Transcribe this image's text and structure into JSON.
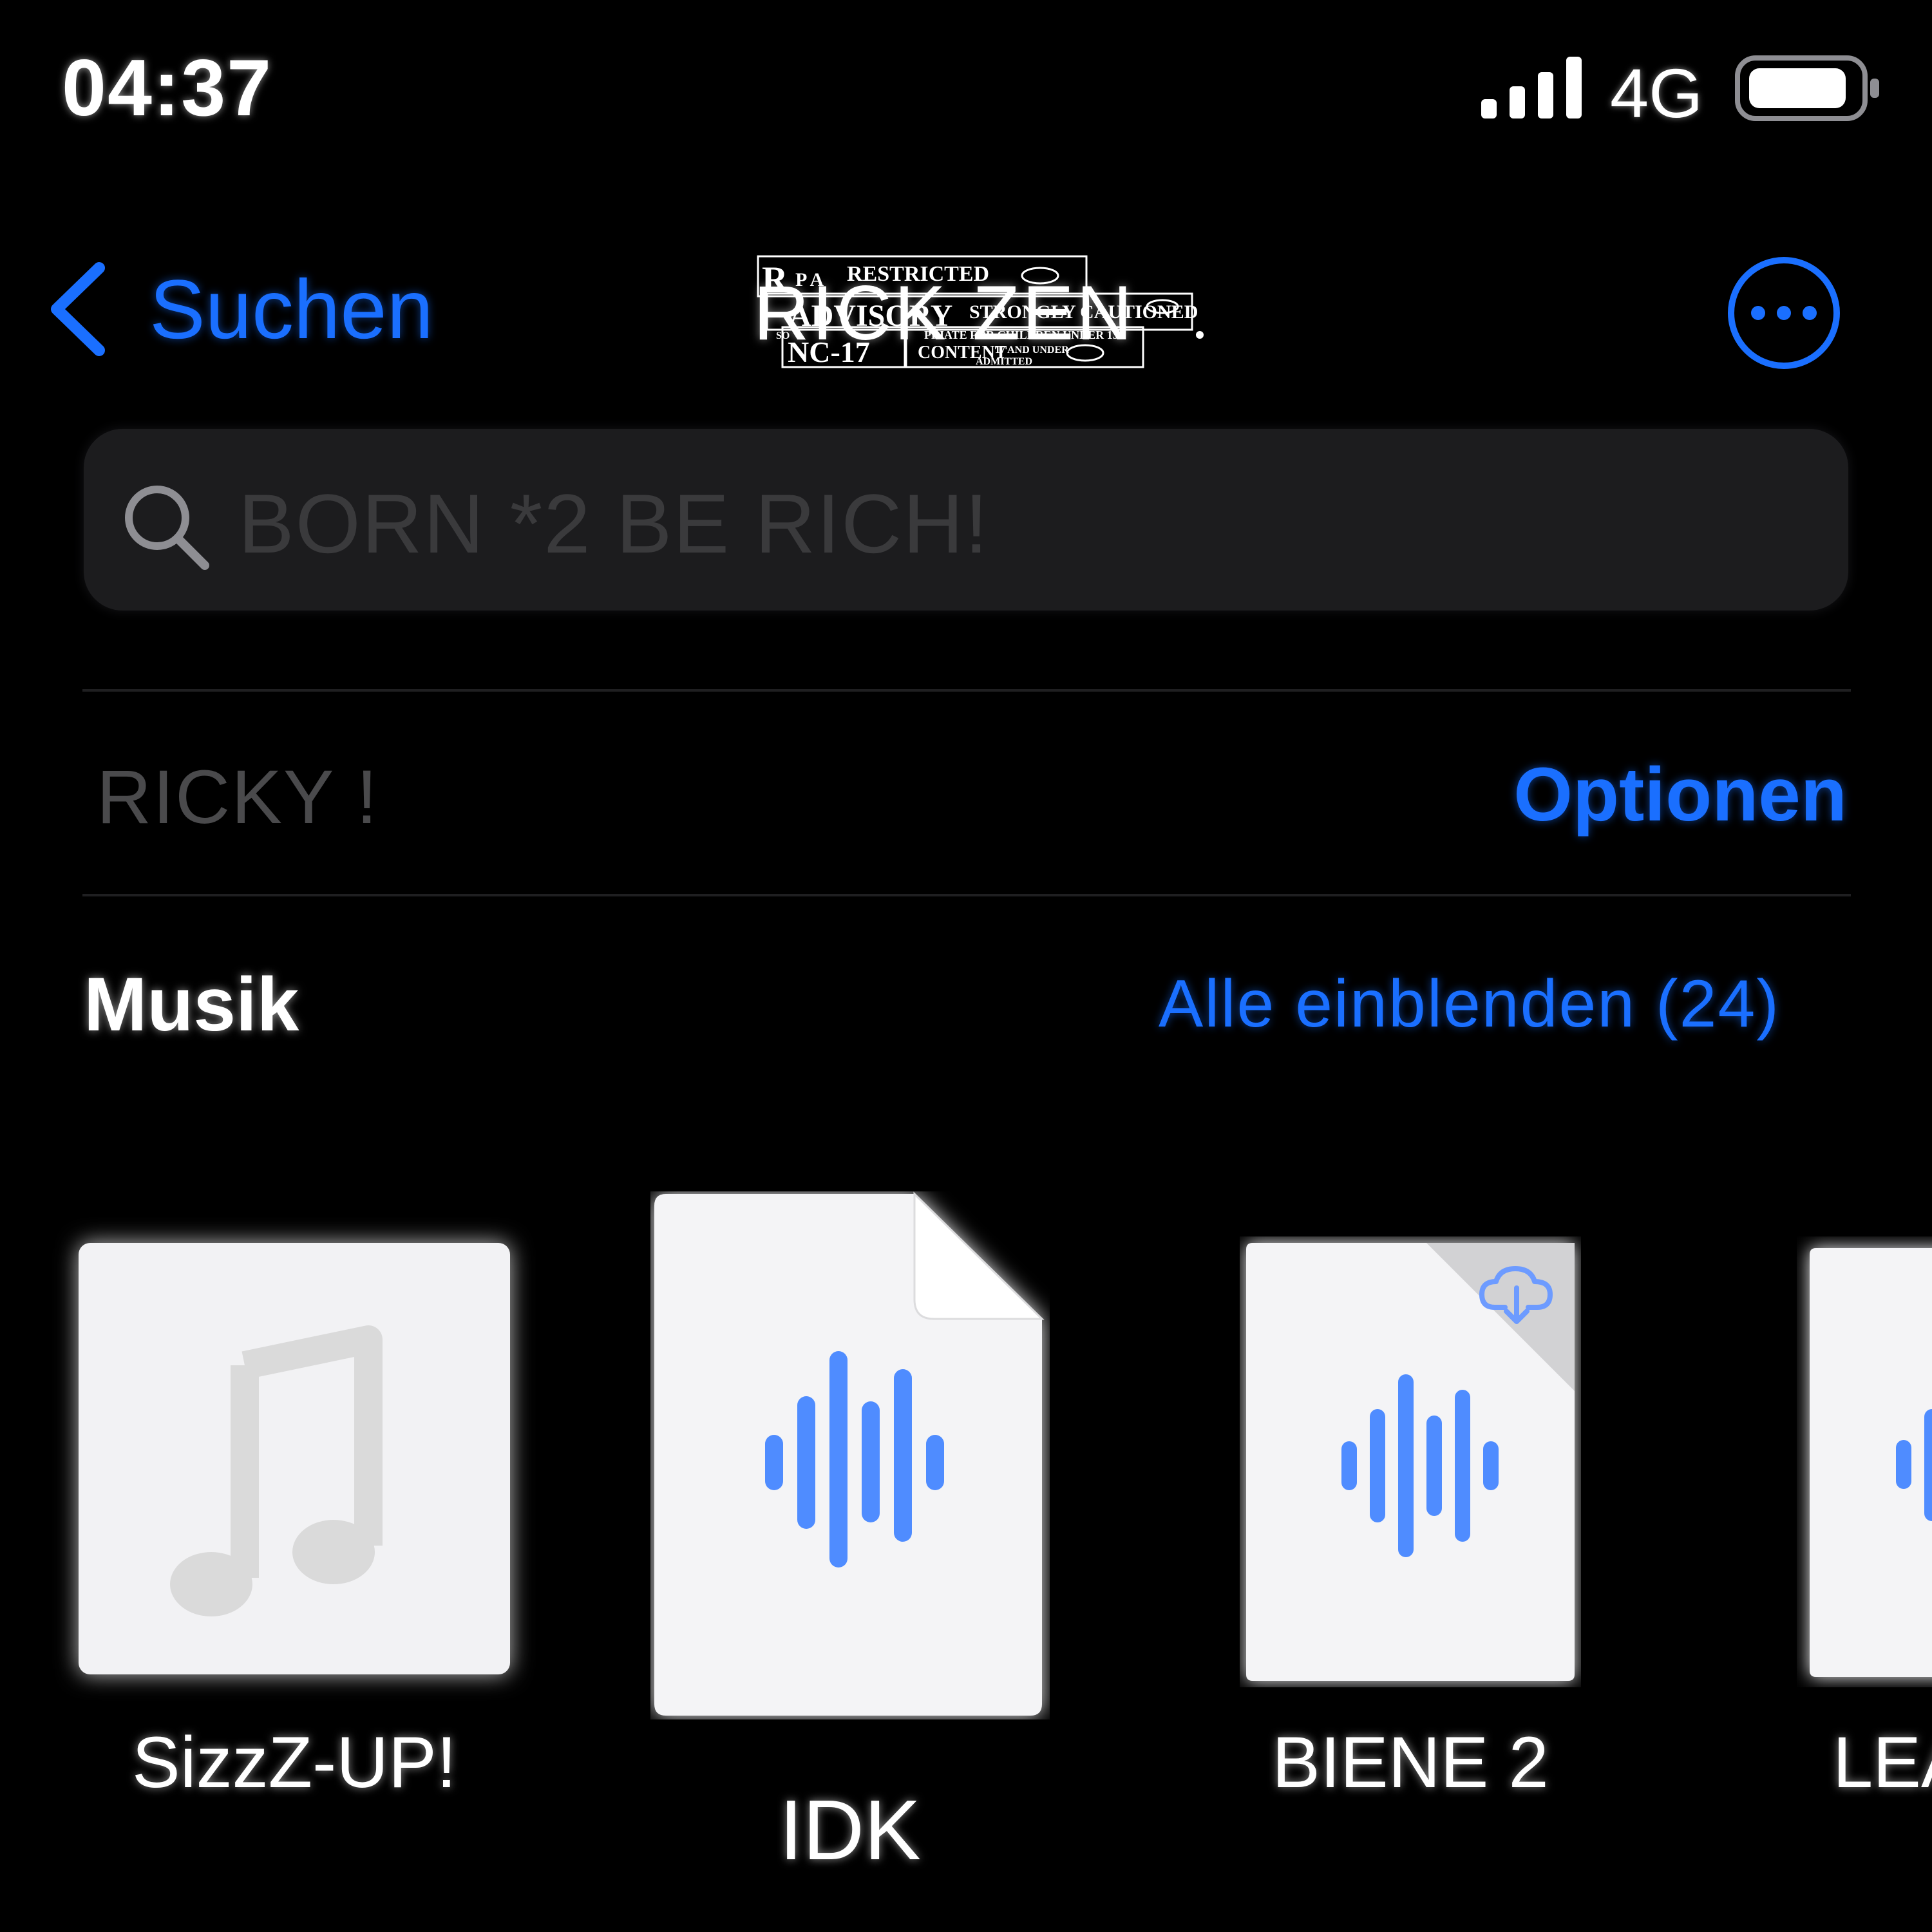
{
  "status_bar": {
    "time": "04:37",
    "network": "4G",
    "signal_bars": 4,
    "battery_level": 0.9
  },
  "nav": {
    "back_label": "Suchen",
    "title": "RICK ZEN",
    "advisory_logo_text": "RESTRICTED ADVISORY STRONGLY CAUTIONED NC-17 ADMITTED",
    "more_icon": "ellipsis-circle-icon"
  },
  "search": {
    "placeholder": "BORN *2 BE RICH!",
    "icon": "search-icon"
  },
  "scope": {
    "label": "RICKY !",
    "options_label": "Optionen"
  },
  "section": {
    "title": "Musik",
    "show_all_label": "Alle einblenden (24)"
  },
  "files": [
    {
      "name": "SizzZ-UP!",
      "icon": "music-note-icon"
    },
    {
      "name": "IDK",
      "icon": "audio-waveform-icon"
    },
    {
      "name": "BIENE 2",
      "icon": "audio-waveform-icon",
      "badge_icon": "cloud-download-icon"
    },
    {
      "name": "LEA",
      "icon": "audio-waveform-icon"
    }
  ],
  "colors": {
    "accent": "#1a6fff",
    "background": "#000000",
    "search_bg": "#1c1c1e",
    "waveform": "#4f8cff",
    "tile": "#f2f2f4"
  }
}
